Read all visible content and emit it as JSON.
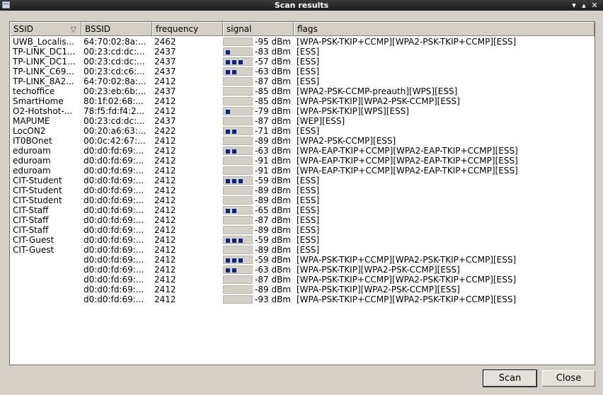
{
  "window": {
    "title": "Scan results",
    "minimize": "▾",
    "maximize": "▴",
    "close": "✕"
  },
  "table": {
    "columns": [
      "SSID",
      "BSSID",
      "frequency",
      "signal",
      "flags"
    ],
    "rows": [
      {
        "ssid": "UWB_Localis...",
        "bssid": "64:70:02:8a:...",
        "freq": "2462",
        "bars": 0,
        "signal": "-95 dBm",
        "flags": "[WPA-PSK-TKIP+CCMP][WPA2-PSK-TKIP+CCMP][ESS]"
      },
      {
        "ssid": "TP-LINK_DC1...",
        "bssid": "00:23:cd:dc:...",
        "freq": "2437",
        "bars": 1,
        "signal": "-83 dBm",
        "flags": "[ESS]"
      },
      {
        "ssid": "TP-LINK_DC1...",
        "bssid": "00:23:cd:dc:...",
        "freq": "2437",
        "bars": 3,
        "signal": "-57 dBm",
        "flags": "[ESS]"
      },
      {
        "ssid": "TP-LINK_C69...",
        "bssid": "00:23:cd:c6:...",
        "freq": "2437",
        "bars": 2,
        "signal": "-63 dBm",
        "flags": "[ESS]"
      },
      {
        "ssid": "TP-LINK_8A2...",
        "bssid": "64:70:02:8a:...",
        "freq": "2412",
        "bars": 0,
        "signal": "-87 dBm",
        "flags": "[ESS]"
      },
      {
        "ssid": "techoffice",
        "bssid": "00:23:eb:6b:...",
        "freq": "2437",
        "bars": 0,
        "signal": "-85 dBm",
        "flags": "[WPA2-PSK-CCMP-preauth][WPS][ESS]"
      },
      {
        "ssid": "SmartHome",
        "bssid": "80:1f:02:68:...",
        "freq": "2412",
        "bars": 0,
        "signal": "-85 dBm",
        "flags": "[WPA-PSK-TKIP][WPA2-PSK-CCMP][ESS]"
      },
      {
        "ssid": "O2-Hotshot-...",
        "bssid": "78:f5:fd:f4:2...",
        "freq": "2412",
        "bars": 1,
        "signal": "-79 dBm",
        "flags": "[WPA-PSK-TKIP][WPS][ESS]"
      },
      {
        "ssid": "MAPUME",
        "bssid": "00:23:cd:dc:...",
        "freq": "2437",
        "bars": 0,
        "signal": "-87 dBm",
        "flags": "[WEP][ESS]"
      },
      {
        "ssid": "LocON2",
        "bssid": "00:20:a6:63:...",
        "freq": "2422",
        "bars": 2,
        "signal": "-71 dBm",
        "flags": "[ESS]"
      },
      {
        "ssid": "IT0BOnet",
        "bssid": "00:0c:42:67:...",
        "freq": "2412",
        "bars": 0,
        "signal": "-89 dBm",
        "flags": "[WPA2-PSK-CCMP][ESS]"
      },
      {
        "ssid": "eduroam",
        "bssid": "d0:d0:fd:69:...",
        "freq": "2412",
        "bars": 2,
        "signal": "-63 dBm",
        "flags": "[WPA-EAP-TKIP+CCMP][WPA2-EAP-TKIP+CCMP][ESS]"
      },
      {
        "ssid": "eduroam",
        "bssid": "d0:d0:fd:69:...",
        "freq": "2412",
        "bars": 0,
        "signal": "-91 dBm",
        "flags": "[WPA-EAP-TKIP+CCMP][WPA2-EAP-TKIP+CCMP][ESS]"
      },
      {
        "ssid": "eduroam",
        "bssid": "d0:d0:fd:69:...",
        "freq": "2412",
        "bars": 0,
        "signal": "-91 dBm",
        "flags": "[WPA-EAP-TKIP+CCMP][WPA2-EAP-TKIP+CCMP][ESS]"
      },
      {
        "ssid": "CIT-Student",
        "bssid": "d0:d0:fd:69:...",
        "freq": "2412",
        "bars": 3,
        "signal": "-59 dBm",
        "flags": "[ESS]"
      },
      {
        "ssid": "CIT-Student",
        "bssid": "d0:d0:fd:69:...",
        "freq": "2412",
        "bars": 0,
        "signal": "-89 dBm",
        "flags": "[ESS]"
      },
      {
        "ssid": "CIT-Student",
        "bssid": "d0:d0:fd:69:...",
        "freq": "2412",
        "bars": 0,
        "signal": "-89 dBm",
        "flags": "[ESS]"
      },
      {
        "ssid": "CIT-Staff",
        "bssid": "d0:d0:fd:69:...",
        "freq": "2412",
        "bars": 2,
        "signal": "-65 dBm",
        "flags": "[ESS]"
      },
      {
        "ssid": "CIT-Staff",
        "bssid": "d0:d0:fd:69:...",
        "freq": "2412",
        "bars": 0,
        "signal": "-87 dBm",
        "flags": "[ESS]"
      },
      {
        "ssid": "CIT-Staff",
        "bssid": "d0:d0:fd:69:...",
        "freq": "2412",
        "bars": 0,
        "signal": "-89 dBm",
        "flags": "[ESS]"
      },
      {
        "ssid": "CIT-Guest",
        "bssid": "d0:d0:fd:69:...",
        "freq": "2412",
        "bars": 3,
        "signal": "-59 dBm",
        "flags": "[ESS]"
      },
      {
        "ssid": "CIT-Guest",
        "bssid": "d0:d0:fd:69:...",
        "freq": "2412",
        "bars": 0,
        "signal": "-89 dBm",
        "flags": "[ESS]"
      },
      {
        "ssid": "",
        "bssid": "d0:d0:fd:69:...",
        "freq": "2412",
        "bars": 3,
        "signal": "-59 dBm",
        "flags": "[WPA-PSK-TKIP+CCMP][WPA2-PSK-TKIP+CCMP][ESS]"
      },
      {
        "ssid": "",
        "bssid": "d0:d0:fd:69:...",
        "freq": "2412",
        "bars": 2,
        "signal": "-63 dBm",
        "flags": "[WPA-PSK-TKIP][WPA2-PSK-CCMP][ESS]"
      },
      {
        "ssid": "",
        "bssid": "d0:d0:fd:69:...",
        "freq": "2412",
        "bars": 0,
        "signal": "-87 dBm",
        "flags": "[WPA-PSK-TKIP+CCMP][WPA2-PSK-TKIP+CCMP][ESS]"
      },
      {
        "ssid": "",
        "bssid": "d0:d0:fd:69:...",
        "freq": "2412",
        "bars": 0,
        "signal": "-89 dBm",
        "flags": "[WPA-PSK-TKIP][WPA2-PSK-CCMP][ESS]"
      },
      {
        "ssid": "",
        "bssid": "d0:d0:fd:69:...",
        "freq": "2412",
        "bars": 0,
        "signal": "-93 dBm",
        "flags": "[WPA-PSK-TKIP+CCMP][WPA2-PSK-TKIP+CCMP][ESS]"
      }
    ]
  },
  "buttons": {
    "scan": "Scan",
    "close": "Close"
  },
  "colors": {
    "signal_bar": "#0a2483"
  }
}
